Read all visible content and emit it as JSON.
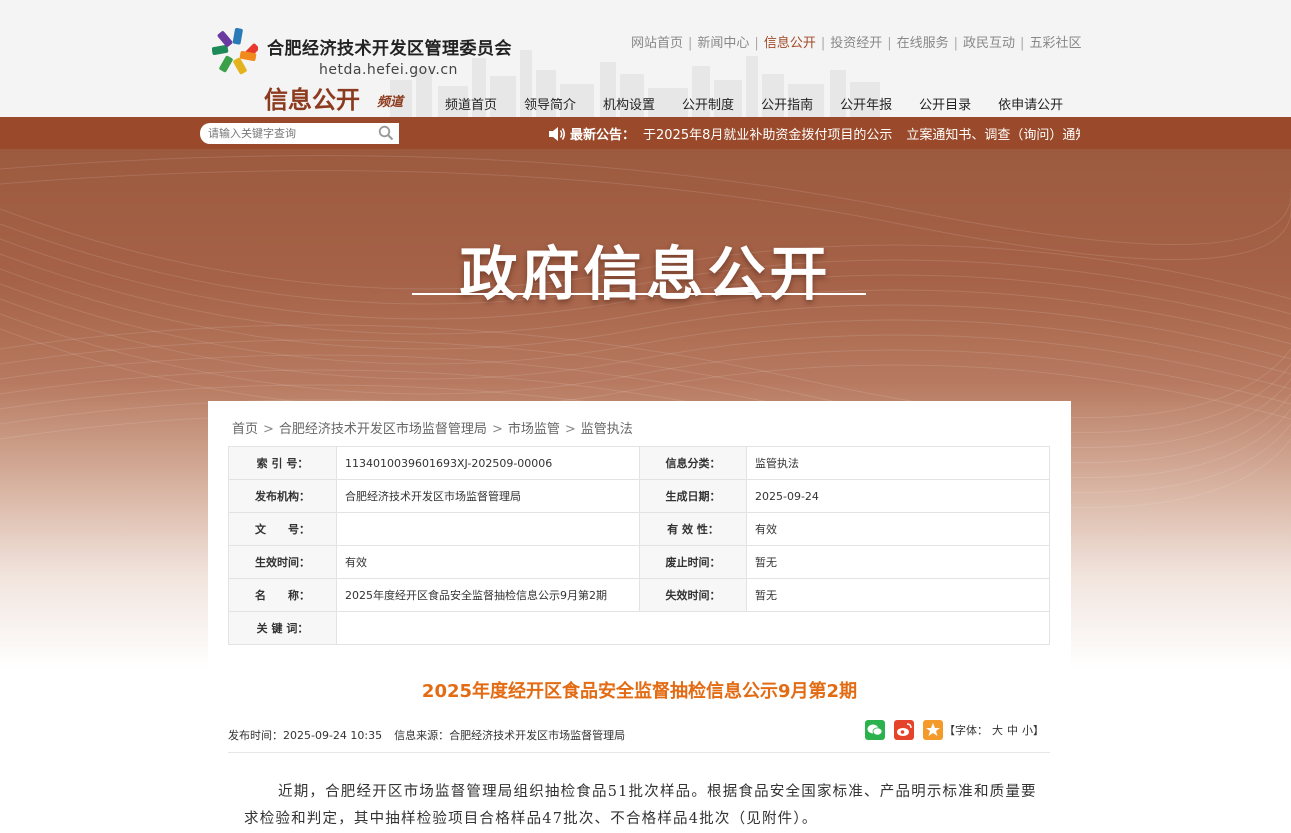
{
  "header": {
    "org_name": "合肥经济技术开发区管理委员会",
    "domain": "hetda.hefei.gov.cn",
    "channel_title": "信息公开",
    "channel_sub": "频道",
    "top_links": [
      "网站首页",
      "新闻中心",
      "信息公开",
      "投资经开",
      "在线服务",
      "政民互动",
      "五彩社区"
    ],
    "active_top_link": "信息公开",
    "nav": [
      "频道首页",
      "领导简介",
      "机构设置",
      "公开制度",
      "公开指南",
      "公开年报",
      "公开目录",
      "依申请公开"
    ]
  },
  "search": {
    "placeholder": "请输入关键字查询"
  },
  "notice": {
    "label": "最新公告：",
    "items": [
      "于2025年8月就业补助资金拨付项目的公示",
      "立案通知书、调查（询问）通知"
    ]
  },
  "banner": {
    "title": "政府信息公开"
  },
  "breadcrumb": [
    "首页",
    "合肥经济技术开发区市场监督管理局",
    "市场监管",
    "监管执法"
  ],
  "meta": {
    "index_label": "索 引 号：",
    "index_value": "1134010039601693XJ-202509-00006",
    "category_label": "信息分类：",
    "category_value": "监管执法",
    "publisher_label": "发布机构：",
    "publisher_value": "合肥经济技术开发区市场监督管理局",
    "date_label": "生成日期：",
    "date_value": "2025-09-24",
    "docno_label": "文　　号：",
    "docno_value": "",
    "validity_label": "有 效 性：",
    "validity_value": "有效",
    "effective_label": "生效时间：",
    "effective_value": "有效",
    "abolish_label": "废止时间：",
    "abolish_value": "暂无",
    "name_label": "名　　称：",
    "name_value": "2025年度经开区食品安全监督抽检信息公示9月第2期",
    "expire_label": "失效时间：",
    "expire_value": "暂无",
    "keywords_label": "关 键 词：",
    "keywords_value": ""
  },
  "article": {
    "title": "2025年度经开区食品安全监督抽检信息公示9月第2期",
    "publish_label": "发布时间：",
    "publish_time": "2025-09-24 10:35",
    "source_label": "信息来源：",
    "source": "合肥经济技术开发区市场监督管理局",
    "font_label": "【字体：",
    "font_large": "大",
    "font_medium": "中",
    "font_small": "小】",
    "body": "近期，合肥经开区市场监督管理局组织抽检食品51批次样品。根据食品安全国家标准、产品明示标准和质量要求检验和判定，其中抽样检验项目合格样品47批次、不合格样品4批次（见附件）。"
  },
  "colors": {
    "brand_brown": "#9a4a2a",
    "title_orange": "#e36b13",
    "active_link": "#a14a28"
  }
}
